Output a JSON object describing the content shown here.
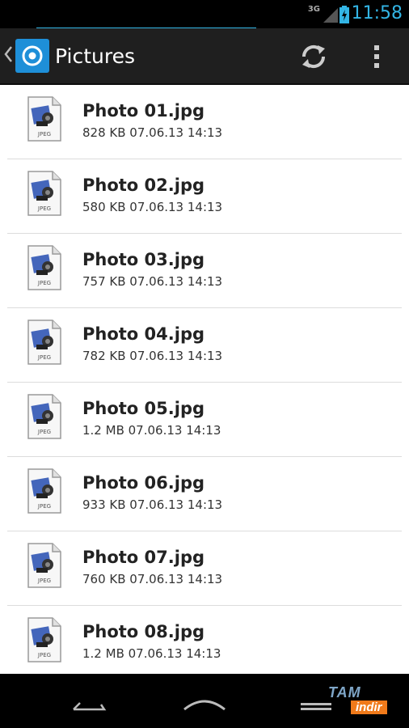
{
  "status_bar": {
    "network": "3G",
    "time": "11:58"
  },
  "action_bar": {
    "title": "Pictures"
  },
  "files": [
    {
      "name": "Photo 01.jpg",
      "meta": "828 KB 07.06.13 14:13",
      "icon_label": "JPEG"
    },
    {
      "name": "Photo 02.jpg",
      "meta": "580 KB 07.06.13 14:13",
      "icon_label": "JPEG"
    },
    {
      "name": "Photo 03.jpg",
      "meta": "757 KB 07.06.13 14:13",
      "icon_label": "JPEG"
    },
    {
      "name": "Photo 04.jpg",
      "meta": "782 KB 07.06.13 14:13",
      "icon_label": "JPEG"
    },
    {
      "name": "Photo 05.jpg",
      "meta": "1.2 MB 07.06.13 14:13",
      "icon_label": "JPEG"
    },
    {
      "name": "Photo 06.jpg",
      "meta": "933 KB 07.06.13 14:13",
      "icon_label": "JPEG"
    },
    {
      "name": "Photo 07.jpg",
      "meta": "760 KB 07.06.13 14:13",
      "icon_label": "JPEG"
    },
    {
      "name": "Photo 08.jpg",
      "meta": "1.2 MB 07.06.13 14:13",
      "icon_label": "JPEG"
    }
  ],
  "watermark": {
    "top": "TAM",
    "bottom": "indir"
  },
  "colors": {
    "accent": "#33b5e5",
    "action_bar": "#1f1f1f",
    "app_icon": "#1e8fd8",
    "watermark_orange": "#f07a1a"
  },
  "icons": {
    "up": "chevron-left-icon",
    "app": "target-icon",
    "refresh": "refresh-icon",
    "overflow": "overflow-menu-icon",
    "file": "jpeg-file-icon",
    "nav_back": "back-icon",
    "nav_home": "home-icon",
    "nav_recent": "recent-apps-icon"
  }
}
